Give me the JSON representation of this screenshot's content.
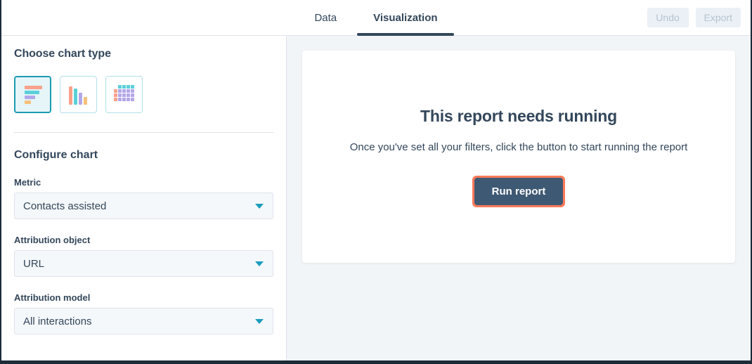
{
  "header": {
    "tabs": [
      {
        "label": "Data",
        "active": false
      },
      {
        "label": "Visualization",
        "active": true
      }
    ],
    "actions": [
      {
        "label": "Undo",
        "disabled": true
      },
      {
        "label": "Export",
        "disabled": true
      }
    ]
  },
  "sidebar": {
    "chart_type_section": {
      "title": "Choose chart type",
      "options": [
        {
          "icon": "horizontal-bar-chart-icon",
          "selected": true
        },
        {
          "icon": "vertical-bar-chart-icon",
          "selected": false
        },
        {
          "icon": "table-grid-icon",
          "selected": false
        }
      ]
    },
    "configure_section": {
      "title": "Configure chart",
      "fields": [
        {
          "label": "Metric",
          "value": "Contacts assisted"
        },
        {
          "label": "Attribution object",
          "value": "URL"
        },
        {
          "label": "Attribution model",
          "value": "All interactions"
        }
      ]
    }
  },
  "main": {
    "empty_state": {
      "title": "This report needs running",
      "subtitle": "Once you've set all your filters, click the button to start running the report",
      "button_label": "Run report"
    }
  },
  "colors": {
    "accent_teal": "#1b9cbd",
    "focus_orange": "#ff7a59",
    "button_navy": "#3e5973",
    "text_navy": "#33475b",
    "panel_bg": "#f2f5f8",
    "icon_salmon": "#f8a18c",
    "icon_teal": "#5bd0d9",
    "icon_purple": "#b4a7e8",
    "icon_yellow": "#f5c07a"
  }
}
